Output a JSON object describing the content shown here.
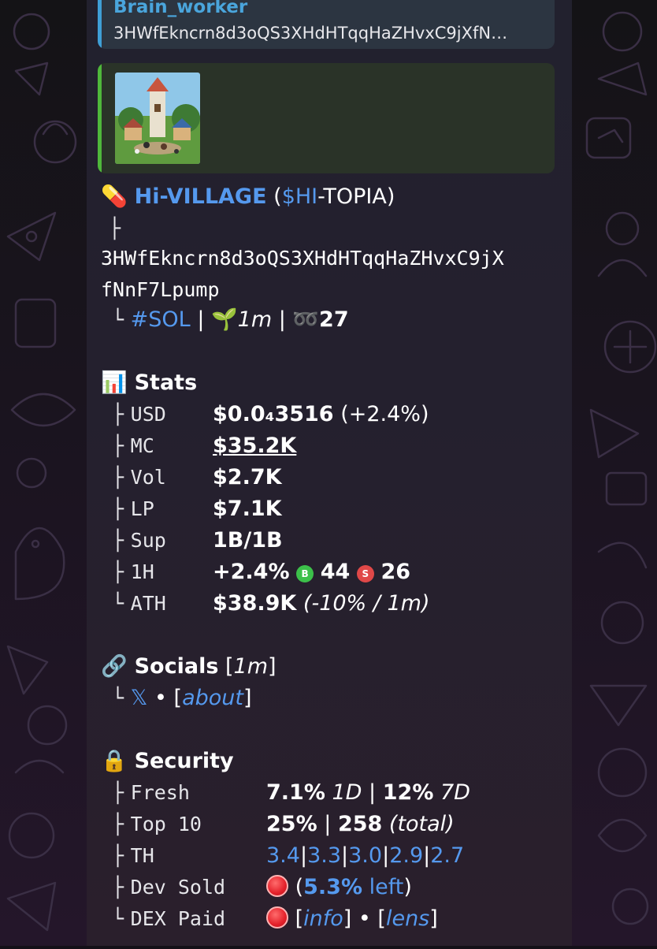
{
  "reply": {
    "author": "Brain_worker",
    "text": "3HWfEkncrn8d3oQS3XHdHTqqHaZHvxC9jXfN…"
  },
  "token": {
    "icon": "pill-icon",
    "name": "Hi-VILLAGE",
    "open_paren": "(",
    "ticker_link": "$HI",
    "ticker_rest": "-TOPIA)",
    "tree_mid": "├",
    "address_line1": "3HWfEkncrn8d3oQS3XHdHTqqHaZHvxC9jX",
    "address_line2": "fNnF7Lpump",
    "tree_end": "└",
    "chain": "#SOL",
    "sep": "|",
    "age": "1m",
    "holders_count": "27"
  },
  "stats": {
    "title": "Stats",
    "rows": [
      {
        "tree": "├",
        "label": "USD",
        "value": "$0.0₄3516",
        "extra": "(+2.4%)"
      },
      {
        "tree": "├",
        "label": "MC",
        "value": "$35.2K",
        "extra": ""
      },
      {
        "tree": "├",
        "label": "Vol",
        "value": "$2.7K",
        "extra": ""
      },
      {
        "tree": "├",
        "label": "LP",
        "value": "$7.1K",
        "extra": ""
      },
      {
        "tree": "├",
        "label": "Sup",
        "value": "1B/1B",
        "extra": ""
      },
      {
        "tree": "├",
        "label": "1H",
        "value": "+2.4%",
        "buys_badge": "B",
        "buys": "44",
        "sells_badge": "S",
        "sells": "26"
      },
      {
        "tree": "└",
        "label": "ATH",
        "value": "$38.9K",
        "extra": "(-10% / 1m)"
      }
    ]
  },
  "socials": {
    "title": "Socials",
    "age_open": "[",
    "age": "1m",
    "age_close": "]",
    "tree": "└",
    "x_icon": "𝕏",
    "bullet": "•",
    "about_open": "[",
    "about": "about",
    "about_close": "]"
  },
  "security": {
    "title": "Security",
    "fresh": {
      "tree": "├",
      "label": "Fresh",
      "v1": "7.1%",
      "p1": "1D",
      "sep": "|",
      "v2": "12%",
      "p2": "7D"
    },
    "top10": {
      "tree": "├",
      "label": "Top 10",
      "v1": "25%",
      "sep": "|",
      "v2": "258",
      "note": "(total)"
    },
    "th": {
      "tree": "├",
      "label": "TH",
      "values": [
        "3.4",
        "3.3",
        "3.0",
        "2.9",
        "2.7"
      ],
      "sep": "|"
    },
    "dev_sold": {
      "tree": "├",
      "label": "Dev Sold",
      "open": "(",
      "pct": "5.3%",
      "left": " left",
      "close": ")"
    },
    "dex_paid": {
      "tree": "└",
      "label": "DEX Paid",
      "info": "info",
      "lens": "lens",
      "bullet": "•"
    }
  },
  "colors": {
    "link": "#5599ee",
    "reply_accent": "#3f9fd6",
    "preview_accent": "#4fb83b",
    "buy_badge": "#3cc04a",
    "sell_badge": "#e04848"
  }
}
